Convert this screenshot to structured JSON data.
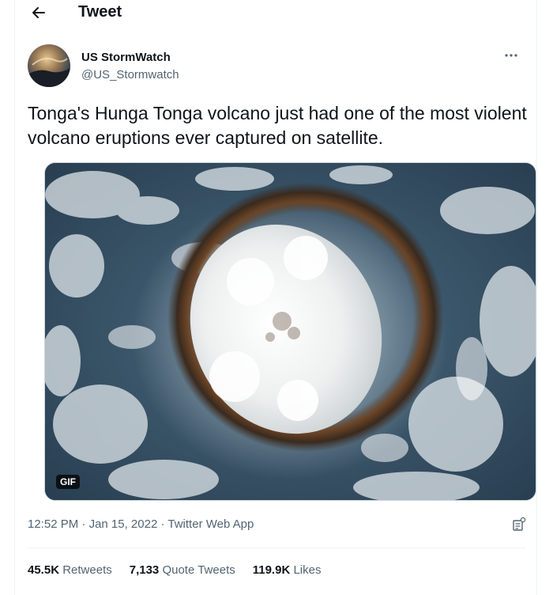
{
  "header": {
    "title": "Tweet",
    "back_icon": "arrow-left-icon"
  },
  "author": {
    "name": "US StormWatch",
    "handle": "@US_Stormwatch",
    "more_icon": "ellipsis-icon"
  },
  "tweet": {
    "text": "Tonga's Hunga Tonga volcano just had one of the most violent volcano eruptions ever captured on satellite.",
    "media_badge": "GIF"
  },
  "meta": {
    "time": "12:52 PM",
    "separator": "·",
    "date": "Jan 15, 2022",
    "source": "Twitter Web App",
    "analytics_icon": "analytics-icon"
  },
  "stats": {
    "retweets_count": "45.5K",
    "retweets_label": "Retweets",
    "quotes_count": "7,133",
    "quotes_label": "Quote Tweets",
    "likes_count": "119.9K",
    "likes_label": "Likes"
  },
  "colors": {
    "text_primary": "#0f1419",
    "text_secondary": "#536471",
    "divider": "#eff3f4"
  }
}
